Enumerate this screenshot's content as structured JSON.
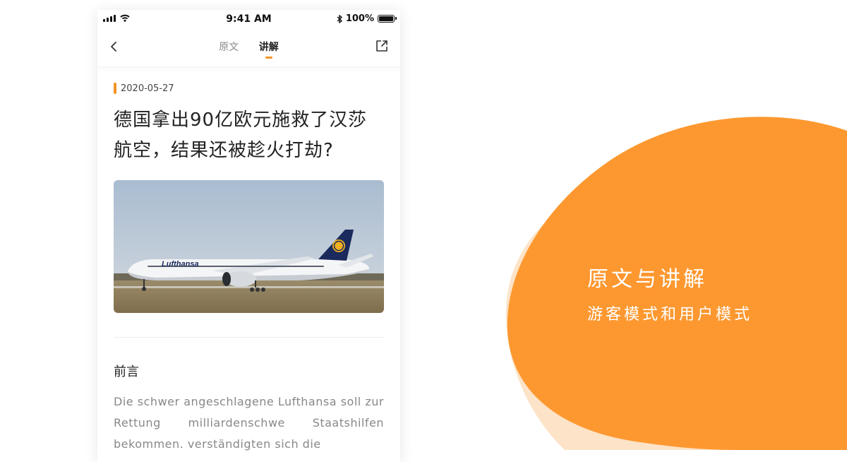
{
  "status_bar": {
    "time": "9:41 AM",
    "battery": "100%",
    "battery_level": 1.0
  },
  "nav": {
    "tabs": [
      {
        "label": "原文",
        "active": false
      },
      {
        "label": "讲解",
        "active": true
      }
    ],
    "back_icon": "chevron-left-icon",
    "share_icon": "share-icon"
  },
  "article": {
    "date": "2020-05-27",
    "title": "德国拿出90亿欧元施救了汉莎航空，结果还被趁火打劫?",
    "hero_image": "lufthansa-airplane-photo",
    "hero_logo_text": "Lufthansa",
    "section_title": "前言",
    "body": "Die schwer angeschlagene Lufthansa soll zur Rettung milliardenschwe Staatshilfen bekommen. verständigten sich die"
  },
  "promo": {
    "title": "原文与讲解",
    "subtitle": "游客模式和用户模式"
  },
  "colors": {
    "accent": "#f39324",
    "blob": "#fd9830",
    "blob_shadow": "#fde3c7"
  }
}
